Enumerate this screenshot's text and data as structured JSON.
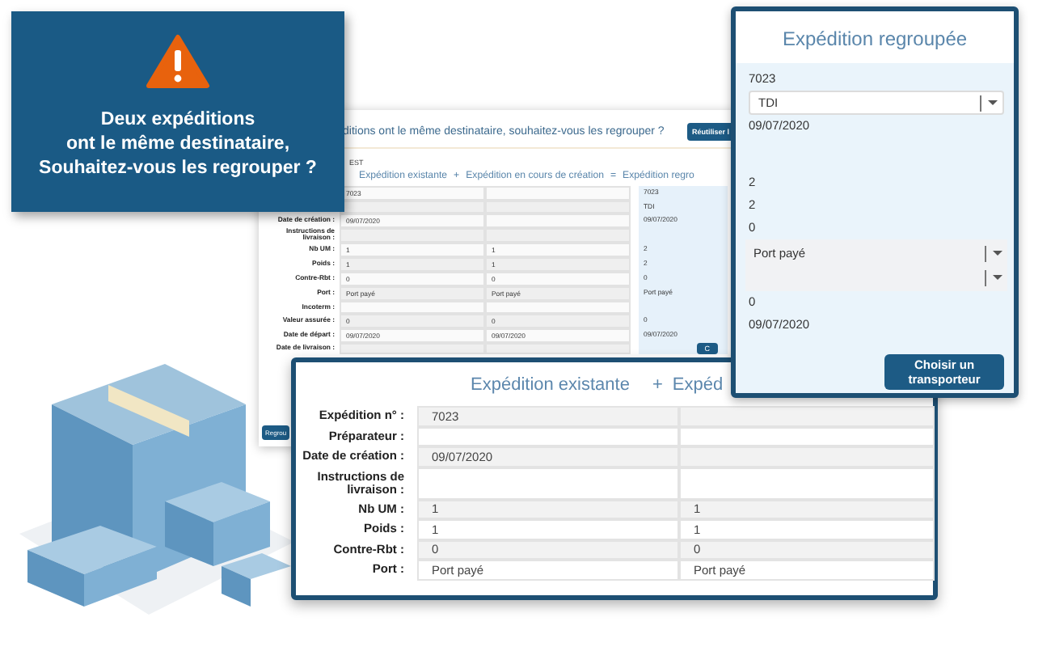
{
  "back_window": {
    "title": "ditions ont le même destinataire, souhaitez-vous les regrouper ?",
    "reuse_button": "Réutiliser l",
    "section_label": "EST",
    "columns": [
      "Expédition existante",
      "+",
      "Expédition en cours de création",
      "=",
      "Expédition regro"
    ],
    "rows": [
      {
        "existing": "7023",
        "merged": "7023"
      },
      {
        "merged": "TDI"
      },
      {
        "label": "Date de création :",
        "existing": "09/07/2020",
        "merged": "09/07/2020"
      },
      {
        "label": "Instructions de livraison :"
      },
      {
        "label": "Nb UM :",
        "existing": "1",
        "new": "1",
        "merged": "2"
      },
      {
        "label": "Poids :",
        "existing": "1",
        "new": "1",
        "merged": "2"
      },
      {
        "label": "Contre-Rbt :",
        "existing": "0",
        "new": "0",
        "merged": "0"
      },
      {
        "label": "Port :",
        "existing": "Port payé",
        "new": "Port payé",
        "merged": "Port payé"
      },
      {
        "label": "Incoterm :"
      },
      {
        "label": "Valeur assurée :",
        "existing": "0",
        "new": "0",
        "merged": "0"
      },
      {
        "label": "Date de départ :",
        "existing": "09/07/2020",
        "new": "09/07/2020",
        "merged": "09/07/2020"
      },
      {
        "label": "Date de livraison :"
      }
    ],
    "group_button": "Regrou",
    "choose_button": "C"
  },
  "front_window": {
    "columns": [
      "Expédition existante",
      "+",
      "Expéd"
    ],
    "rows": [
      {
        "label": "Expédition n° :",
        "existing": "7023"
      },
      {
        "label": "Préparateur :"
      },
      {
        "label": "Date de création :",
        "existing": "09/07/2020"
      },
      {
        "label": "Instructions de livraison :"
      },
      {
        "label": "Nb UM :",
        "existing": "1",
        "new": "1"
      },
      {
        "label": "Poids :",
        "existing": "1",
        "new": "1"
      },
      {
        "label": "Contre-Rbt :",
        "existing": "0",
        "new": "0"
      },
      {
        "label": "Port :",
        "existing": "Port payé",
        "new": "Port payé"
      }
    ]
  },
  "merged_panel": {
    "title": "Expédition regroupée",
    "fields": [
      {
        "kind": "text",
        "value": "7023"
      },
      {
        "kind": "select",
        "value": "TDI"
      },
      {
        "kind": "text",
        "value": "09/07/2020"
      },
      {
        "kind": "gap"
      },
      {
        "kind": "text",
        "value": "2"
      },
      {
        "kind": "text",
        "value": "2"
      },
      {
        "kind": "text",
        "value": "0"
      },
      {
        "kind": "band-select",
        "value": "Port payé"
      },
      {
        "kind": "band-select"
      },
      {
        "kind": "text",
        "value": "0"
      },
      {
        "kind": "text",
        "value": "09/07/2020"
      }
    ],
    "button": "Choisir un transporteur"
  },
  "alert": {
    "lines": [
      "Deux expéditions",
      "ont le même destinataire,",
      "Souhaitez-vous les regrouper ?"
    ]
  }
}
